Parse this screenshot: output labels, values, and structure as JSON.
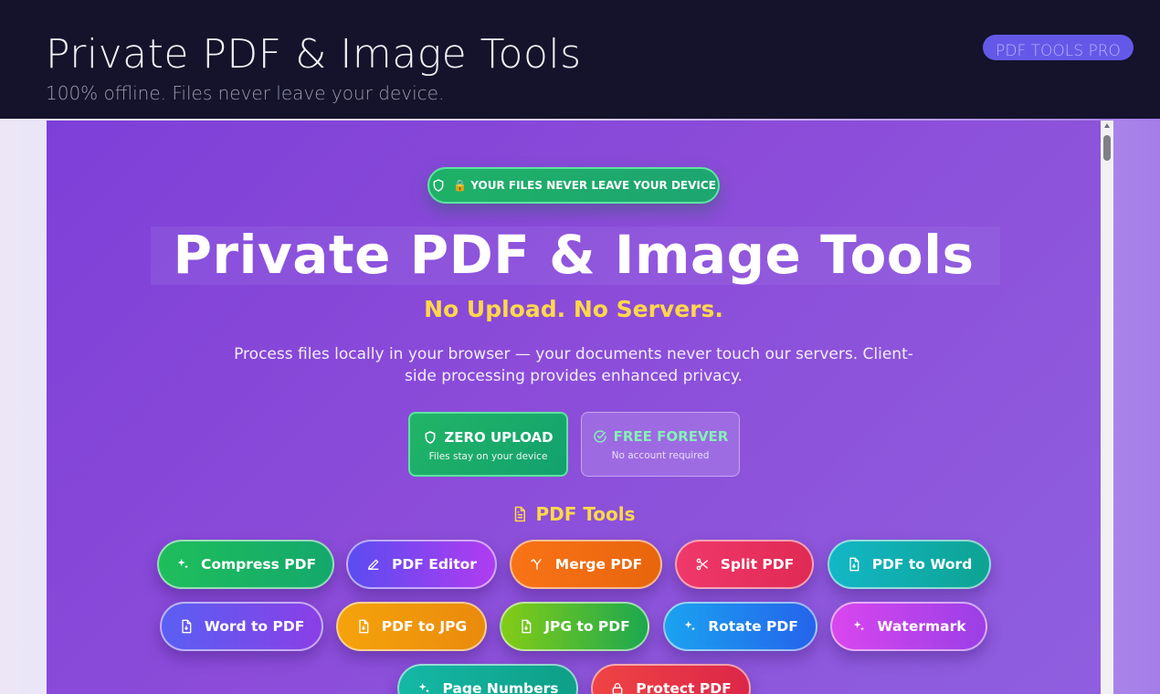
{
  "header": {
    "title": "Private PDF & Image Tools",
    "subtitle": "100% offline. Files never leave your device.",
    "badge": "PDF TOOLS PRO"
  },
  "hero": {
    "privacy_pill": "🔒 YOUR FILES NEVER LEAVE YOUR DEVICE",
    "title": "Private PDF & Image Tools",
    "tagline": "No Upload. No Servers.",
    "description": "Process files locally in your browser — your documents never touch our servers. Client-side processing provides enhanced privacy."
  },
  "features": {
    "zero_upload": {
      "title": "ZERO UPLOAD",
      "subtitle": "Files stay on your device",
      "icon": "shield-icon"
    },
    "free_forever": {
      "title": "FREE FOREVER",
      "subtitle": "No account required",
      "icon": "check-circle-icon"
    }
  },
  "pdf_tools": {
    "section_title": "PDF Tools",
    "section_icon": "document-icon",
    "items": [
      {
        "label": "Compress PDF",
        "icon": "sparkle-icon",
        "colors": [
          "#1fbe5b",
          "#14a86c"
        ]
      },
      {
        "label": "PDF Editor",
        "icon": "pen-icon",
        "colors": [
          "#5b4cf0",
          "#b03cf0"
        ]
      },
      {
        "label": "Merge PDF",
        "icon": "merge-icon",
        "colors": [
          "#f97316",
          "#e8650c"
        ]
      },
      {
        "label": "Split PDF",
        "icon": "scissors-icon",
        "colors": [
          "#f0386b",
          "#e02a54"
        ]
      },
      {
        "label": "PDF to Word",
        "icon": "file-icon",
        "colors": [
          "#12b7c6",
          "#0ea393"
        ]
      },
      {
        "label": "Word to PDF",
        "icon": "file-icon",
        "colors": [
          "#5a5ff3",
          "#8a3fe6"
        ]
      },
      {
        "label": "PDF to JPG",
        "icon": "file-icon",
        "colors": [
          "#f5a30b",
          "#ea8a0c"
        ]
      },
      {
        "label": "JPG to PDF",
        "icon": "file-icon",
        "colors": [
          "#84cc16",
          "#1ca84f"
        ]
      },
      {
        "label": "Rotate PDF",
        "icon": "sparkle-icon",
        "colors": [
          "#1aa3f0",
          "#2563eb"
        ]
      },
      {
        "label": "Watermark",
        "icon": "sparkle-icon",
        "colors": [
          "#d946ef",
          "#9b3fe6"
        ]
      },
      {
        "label": "Page Numbers",
        "icon": "sparkle-icon",
        "colors": [
          "#14b8a6",
          "#0e9f87"
        ]
      },
      {
        "label": "Protect PDF",
        "icon": "lock-icon",
        "colors": [
          "#ef4444",
          "#dc2648"
        ]
      }
    ]
  }
}
